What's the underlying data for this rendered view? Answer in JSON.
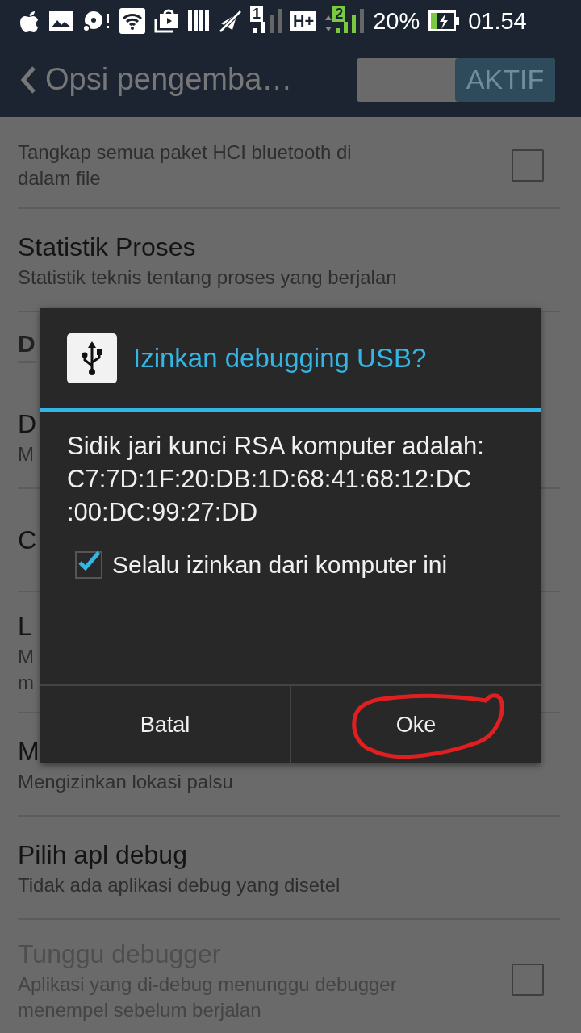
{
  "status_bar": {
    "sim1": "1",
    "network": "H+",
    "sim2": "2",
    "battery": "20%",
    "time": "01.54"
  },
  "action_bar": {
    "title": "Opsi pengemba…",
    "toggle": {
      "label": "AKTIF",
      "on": true
    }
  },
  "settings": [
    {
      "kind": "item",
      "subtitle": [
        "Tangkap semua paket HCI bluetooth di",
        "dalam file"
      ],
      "checked": false,
      "disabled": false
    },
    {
      "kind": "item",
      "title": "Statistik Proses",
      "subtitle": [
        "Statistik teknis tentang proses yang berjalan"
      ],
      "disabled": false
    },
    {
      "kind": "section",
      "title": "D"
    },
    {
      "kind": "item",
      "title": "D",
      "subtitle": [
        "M"
      ],
      "disabled": false
    },
    {
      "kind": "item",
      "title": "C",
      "disabled": false
    },
    {
      "kind": "item",
      "title": "L",
      "subtitle": [
        "M",
        "m"
      ],
      "disabled": false
    },
    {
      "kind": "item",
      "title": "M",
      "subtitle": [
        "Mengizinkan lokasi palsu"
      ],
      "disabled": false
    },
    {
      "kind": "item",
      "title": "Pilih apl debug",
      "subtitle": [
        "Tidak ada aplikasi debug yang disetel"
      ],
      "disabled": false
    },
    {
      "kind": "item",
      "title": "Tunggu debugger",
      "subtitle": [
        "Aplikasi yang di-debug menunggu debugger",
        "menempel sebelum berjalan"
      ],
      "checked": false,
      "disabled": true
    }
  ],
  "dialog": {
    "title": "Izinkan debugging USB?",
    "message": "Sidik jari kunci RSA komputer adalah:\nC7:7D:1F:20:DB:1D:68:41:68:12:DC\n:00:DC:99:27:DD",
    "checkbox": {
      "label": "Selalu izinkan dari komputer ini",
      "checked": true
    },
    "buttons": [
      {
        "label": "Batal",
        "circled": false
      },
      {
        "label": "Oke",
        "circled": true
      }
    ]
  }
}
